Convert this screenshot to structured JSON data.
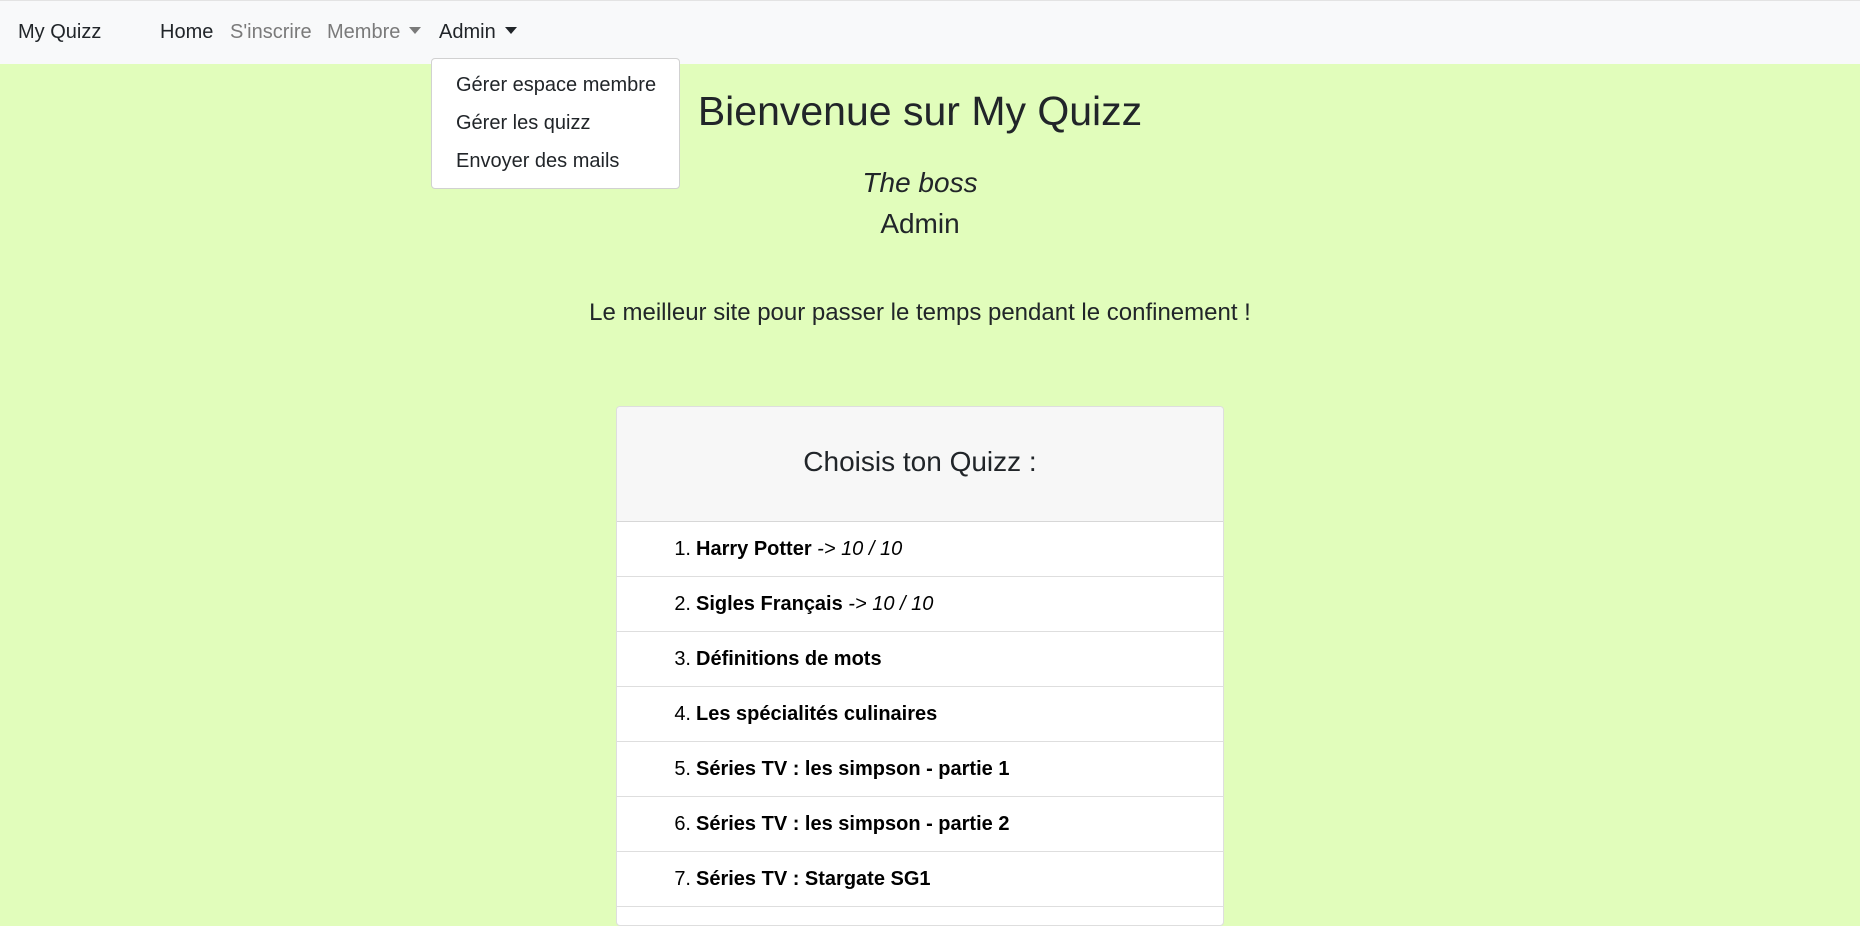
{
  "navbar": {
    "brand": "My Quizz",
    "links": {
      "home": "Home",
      "signup": "S'inscrire",
      "membre": "Membre",
      "admin": "Admin"
    }
  },
  "admin_menu": {
    "items": [
      "Gérer espace membre",
      "Gérer les quizz",
      "Envoyer des mails"
    ]
  },
  "main": {
    "title": "Bienvenue sur My Quizz",
    "user_role": "The boss",
    "user_status": "Admin",
    "tagline": "Le meilleur site pour passer le temps pendant le confinement !"
  },
  "quiz_card": {
    "header": "Choisis ton Quizz :",
    "items": [
      {
        "num": "1.",
        "name": "Harry Potter",
        "score": " -> 10 / 10"
      },
      {
        "num": "2.",
        "name": "Sigles Français",
        "score": " -> 10 / 10"
      },
      {
        "num": "3.",
        "name": "Définitions de mots",
        "score": ""
      },
      {
        "num": "4.",
        "name": "Les spécialités culinaires",
        "score": ""
      },
      {
        "num": "5.",
        "name": "Séries TV : les simpson - partie 1",
        "score": ""
      },
      {
        "num": "6.",
        "name": "Séries TV : les simpson - partie 2",
        "score": ""
      },
      {
        "num": "7.",
        "name": "Séries TV : Stargate SG1",
        "score": ""
      }
    ]
  },
  "colors": {
    "page_background": "#e1fdbb",
    "navbar_background": "#f8f9fa",
    "muted_link": "#7a7a7a"
  }
}
